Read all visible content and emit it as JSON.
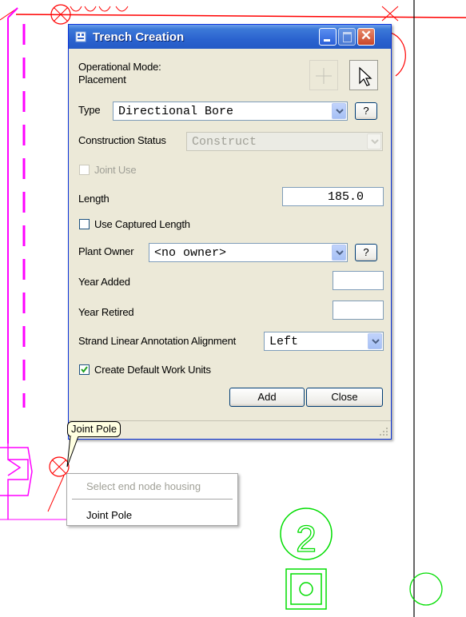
{
  "window": {
    "title": "Trench Creation"
  },
  "mode": {
    "label_line1": "Operational Mode:",
    "label_line2": "Placement"
  },
  "type": {
    "label": "Type",
    "value": "Directional Bore",
    "help": "?"
  },
  "construction_status": {
    "label": "Construction Status",
    "value": "Construct"
  },
  "joint_use": {
    "label": "Joint Use",
    "checked": false
  },
  "length": {
    "label": "Length",
    "value": "185.0"
  },
  "use_captured_length": {
    "label": "Use Captured Length",
    "checked": false
  },
  "plant_owner": {
    "label": "Plant Owner",
    "value": "<no owner>",
    "help": "?"
  },
  "year_added": {
    "label": "Year Added",
    "value": ""
  },
  "year_retired": {
    "label": "Year Retired",
    "value": ""
  },
  "strand_alignment": {
    "label": "Strand Linear Annotation Alignment",
    "value": "Left"
  },
  "create_work_units": {
    "label": "Create Default Work Units",
    "checked": true
  },
  "buttons": {
    "add": "Add",
    "close": "Close"
  },
  "tooltip": {
    "text": "Joint Pole"
  },
  "context_menu": {
    "header": "Select end node housing",
    "items": [
      "Joint Pole"
    ]
  },
  "canvas": {
    "node_label": "2",
    "colors": {
      "pole_lines": "#ff00ff",
      "red_lines": "#ff0000",
      "green_symbols": "#00dd00",
      "black_line": "#000000"
    }
  }
}
